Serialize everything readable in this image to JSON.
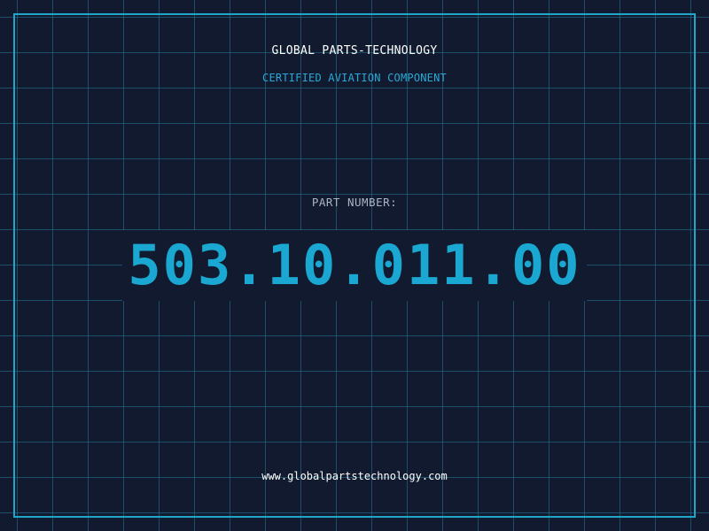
{
  "header": {
    "company": "GLOBAL PARTS-TECHNOLOGY",
    "subtitle": "CERTIFIED AVIATION COMPONENT"
  },
  "part": {
    "label": "PART NUMBER:",
    "number": "503.10.011.00"
  },
  "footer": {
    "url": "www.globalpartstechnology.com"
  },
  "colors": {
    "background": "#111a2e",
    "grid": "#26788f",
    "accent": "#1aa8d2",
    "text": "#ffffff",
    "muted": "#aab6c6"
  }
}
